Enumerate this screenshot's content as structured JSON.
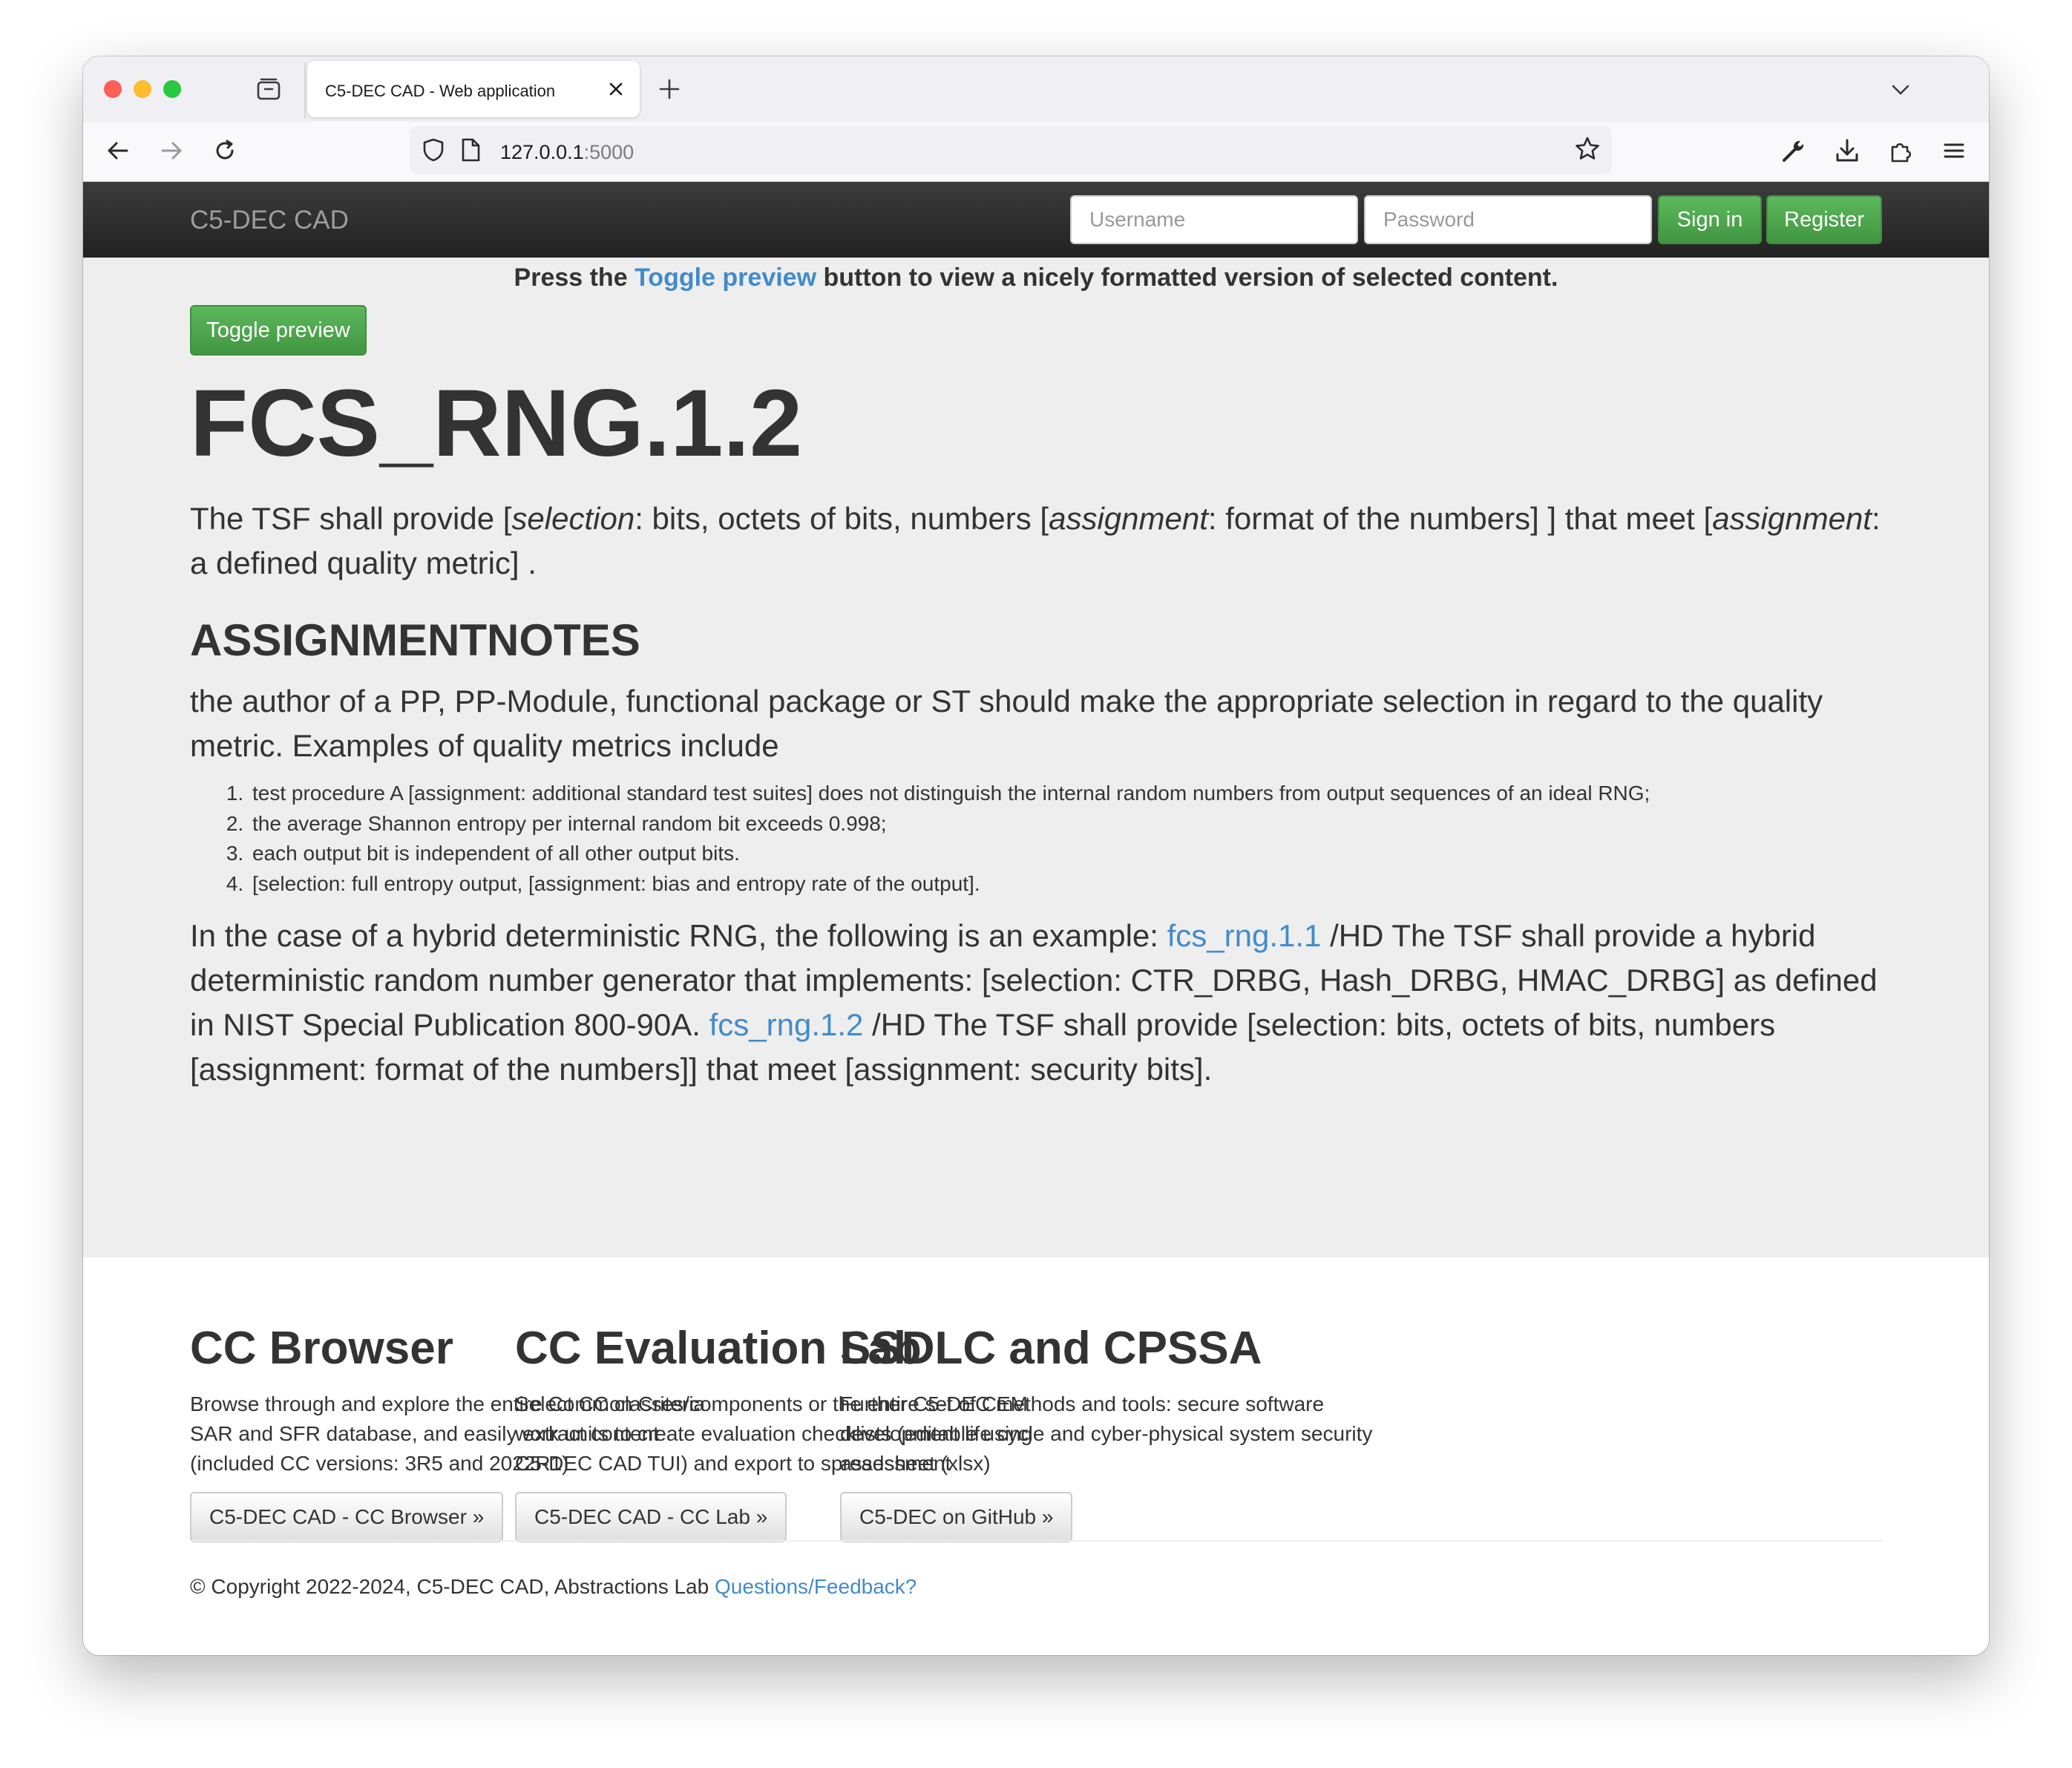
{
  "browser": {
    "tab_title": "C5-DEC CAD - Web application",
    "url_host": "127.0.0.1",
    "url_port": ":5000"
  },
  "appnav": {
    "brand": "C5-DEC CAD",
    "username_placeholder": "Username",
    "password_placeholder": "Password",
    "signin_label": "Sign in",
    "register_label": "Register"
  },
  "content": {
    "hint_before": "Press the ",
    "hint_link": "Toggle preview",
    "hint_after": " button to view a nicely formatted version of selected content.",
    "toggle_label": "Toggle preview",
    "title": "FCS_RNG.1.2",
    "statement": {
      "t1": "The TSF shall provide [",
      "sel": "selection",
      "t2": ": bits, octets of bits, numbers [",
      "asg1": "assignment",
      "t3": ": format of the numbers] ] that meet [",
      "asg2": "assignment",
      "t4": ": a defined quality metric] ."
    },
    "section_heading": "ASSIGNMENTNOTES",
    "notes": "the author of a PP, PP-Module, functional package or ST should make the appropriate selection in regard to the quality metric. Examples of quality metrics include",
    "list": [
      "test procedure A [assignment: additional standard test suites] does not distinguish the internal random numbers from output sequences of an ideal RNG;",
      "the average Shannon entropy per internal random bit exceeds 0.998;",
      "each output bit is independent of all other output bits.",
      "[selection: full entropy output, [assignment: bias and entropy rate of the output]."
    ],
    "example": {
      "t1": "In the case of a hybrid deterministic RNG, the following is an example: ",
      "link1": "fcs_rng.1.1",
      "t2": " /HD The TSF shall provide a hybrid deterministic random number generator that implements: [selection: CTR_DRBG, Hash_DRBG, HMAC_DRBG] as defined in NIST Special Publication 800-90A. ",
      "link2": "fcs_rng.1.2",
      "t3": " /HD The TSF shall provide [selection: bits, octets of bits, numbers [assignment: format of the numbers]] that meet [assignment: security bits]."
    }
  },
  "columns": [
    {
      "heading": "CC Browser",
      "text": "Browse through and explore the entire Common Criteria SAR and SFR database, and easily extract content (included CC versions: 3R5 and 2022R1)",
      "button": "C5-DEC CAD - CC Browser »"
    },
    {
      "heading": "CC Evaluation Lab",
      "text": "Select CC classes/components or the entire set of CEM work units to create evaluation checklists (editable using C5-DEC CAD TUI) and export to spreadsheet (xlsx)",
      "button": "C5-DEC CAD - CC Lab »"
    },
    {
      "heading": "SSDLC and CPSSA",
      "text": "Further C5-DEC methods and tools: secure software development life cycle and cyber-physical system security assessment",
      "button": "C5-DEC on GitHub »"
    }
  ],
  "footer": {
    "copyright": "© Copyright 2022-2024, C5-DEC CAD, Abstractions Lab ",
    "feedback_link": "Questions/Feedback?"
  },
  "colors": {
    "navbar_dark": "#222222",
    "jumbotron_bg": "#eeeeee",
    "success_green": "#5cb85c",
    "link_blue": "#428bca"
  },
  "icons": {
    "tab_overview": "tab-overview-icon",
    "back": "back-arrow-icon",
    "forward": "forward-arrow-icon",
    "reload": "reload-icon",
    "shield": "shield-icon",
    "page": "page-icon",
    "bookmark": "star-icon",
    "tools": "wrench-icon",
    "downloads": "download-icon",
    "extensions": "puzzle-icon",
    "menu": "hamburger-menu-icon"
  }
}
